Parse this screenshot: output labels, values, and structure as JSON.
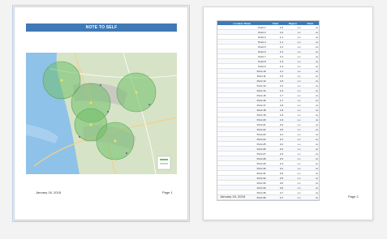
{
  "window": {
    "background": "#f3f3f3",
    "accent": "#3f79b6"
  },
  "page1": {
    "title": "NOTE TO SELF",
    "footer_left": "January 16, 2018",
    "footer_right": "Page 1"
  },
  "page2": {
    "table": {
      "headers": [
        "Location Name",
        "Field",
        "Region",
        "Value"
      ],
      "rows": [
        [
          "Point 1",
          "1.0",
          "x.x",
          "xx"
        ],
        [
          "Point 2",
          "1.0",
          "x.x",
          "xx"
        ],
        [
          "Point 3",
          "1.1",
          "x.x",
          "xx"
        ],
        [
          "Point 4",
          "1.1",
          "x.x",
          "xx"
        ],
        [
          "Point 5",
          "1.2",
          "x.x",
          "xx"
        ],
        [
          "Point 6",
          "1.2",
          "x.x",
          "xx"
        ],
        [
          "Point 7",
          "1.3",
          "x.x",
          "xx"
        ],
        [
          "Point 8",
          "1.3",
          "x.x",
          "xx"
        ],
        [
          "Point 9",
          "1.4",
          "x.x",
          "xx"
        ],
        [
          "Point 10",
          "1.4",
          "x.x",
          "xx"
        ],
        [
          "Point 11",
          "1.5",
          "x.x",
          "xx"
        ],
        [
          "Point 12",
          "1.5",
          "x.x",
          "xx"
        ],
        [
          "Point 13",
          "1.6",
          "x.x",
          "xx"
        ],
        [
          "Point 14",
          "1.6",
          "x.x",
          "xx"
        ],
        [
          "Point 15",
          "1.7",
          "x.x",
          "xx"
        ],
        [
          "Point 16",
          "1.7",
          "x.x",
          "xx"
        ],
        [
          "Point 17",
          "1.8",
          "x.x",
          "xx"
        ],
        [
          "Point 18",
          "1.8",
          "x.x",
          "xx"
        ],
        [
          "Point 19",
          "1.9",
          "x.x",
          "xx"
        ],
        [
          "Point 20",
          "1.9",
          "x.x",
          "xx"
        ],
        [
          "Point 21",
          "2.0",
          "x.x",
          "xx"
        ],
        [
          "Point 22",
          "2.0",
          "x.x",
          "xx"
        ],
        [
          "Point 23",
          "2.1",
          "x.x",
          "xx"
        ],
        [
          "Point 24",
          "2.1",
          "x.x",
          "xx"
        ],
        [
          "Point 25",
          "2.2",
          "x.x",
          "xx"
        ],
        [
          "Point 26",
          "2.2",
          "x.x",
          "xx"
        ],
        [
          "Point 27",
          "2.3",
          "x.x",
          "xx"
        ],
        [
          "Point 28",
          "2.3",
          "x.x",
          "xx"
        ],
        [
          "Point 29",
          "2.4",
          "x.x",
          "xx"
        ],
        [
          "Point 30",
          "2.4",
          "x.x",
          "xx"
        ],
        [
          "Point 31",
          "2.5",
          "x.x",
          "xx"
        ],
        [
          "Point 32",
          "2.5",
          "x.x",
          "xx"
        ],
        [
          "Point 33",
          "2.6",
          "x.x",
          "xx"
        ],
        [
          "Point 34",
          "2.6",
          "x.x",
          "xx"
        ],
        [
          "Point 35",
          "2.7",
          "x.x",
          "xx"
        ],
        [
          "Point 36",
          "2.7",
          "x.x",
          "xx"
        ]
      ]
    },
    "footer_left": "January 16, 2018",
    "footer_right": "Page 2"
  }
}
